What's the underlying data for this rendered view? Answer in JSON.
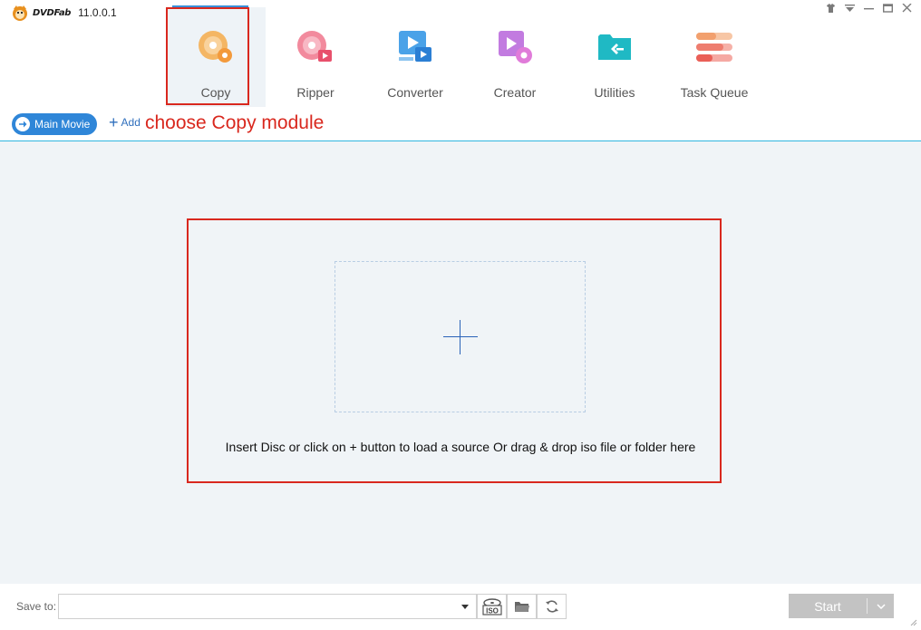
{
  "app": {
    "brand": "DVDFab",
    "version": "11.0.0.1"
  },
  "window_controls": [
    {
      "name": "skin-icon"
    },
    {
      "name": "menu-icon"
    },
    {
      "name": "minimize-icon"
    },
    {
      "name": "maximize-icon"
    },
    {
      "name": "close-icon"
    }
  ],
  "modules": [
    {
      "label": "Copy",
      "icon": "copy-disc-icon",
      "active": true
    },
    {
      "label": "Ripper",
      "icon": "ripper-icon"
    },
    {
      "label": "Converter",
      "icon": "converter-icon"
    },
    {
      "label": "Creator",
      "icon": "creator-icon"
    },
    {
      "label": "Utilities",
      "icon": "utilities-icon"
    },
    {
      "label": "Task Queue",
      "icon": "task-queue-icon"
    }
  ],
  "toolbar": {
    "main_movie_label": "Main Movie",
    "add_label": "Add"
  },
  "annotation": {
    "text": "choose Copy module",
    "color": "#d9281e"
  },
  "dropzone": {
    "hint": "Insert Disc or click on + button to load a source Or drag & drop iso file or folder here"
  },
  "bottom": {
    "save_to_label": "Save to:",
    "save_path": "",
    "iso_label": "ISO",
    "start_label": "Start"
  },
  "colors": {
    "accent": "#2f86d8",
    "highlight": "#d9281e",
    "main_bg": "#f0f4f7",
    "divider": "#30b6e0"
  }
}
